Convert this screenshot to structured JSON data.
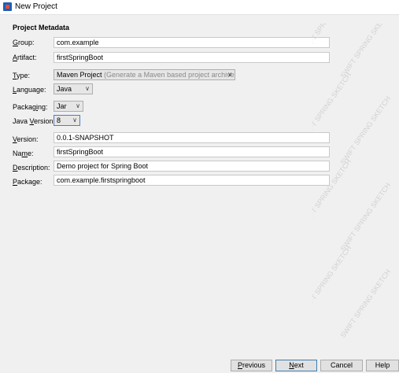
{
  "window": {
    "title": "New Project"
  },
  "section": {
    "title": "Project Metadata"
  },
  "fields": {
    "group": {
      "label_mnemonic": "G",
      "label_rest": "roup:",
      "value": "com.example"
    },
    "artifact": {
      "label_mnemonic": "A",
      "label_rest": "rtifact:",
      "value": "firstSpringBoot"
    },
    "type": {
      "label_mnemonic": "T",
      "label_rest": "ype:",
      "value": "Maven Project",
      "hint": "(Generate a Maven based project archive.)"
    },
    "language": {
      "label_mnemonic": "L",
      "label_rest": "anguage:",
      "value": "Java"
    },
    "packaging": {
      "label_pre": "Packag",
      "label_mnemonic": "i",
      "label_rest": "ng:",
      "value": "Jar"
    },
    "java_version": {
      "label_pre": "Java ",
      "label_mnemonic": "V",
      "label_rest": "ersion:",
      "value": "8"
    },
    "version": {
      "label_mnemonic": "V",
      "label_rest": "ersion:",
      "value": "0.0.1-SNAPSHOT"
    },
    "name": {
      "label_pre": "Na",
      "label_mnemonic": "m",
      "label_rest": "e:",
      "value": "firstSpringBoot"
    },
    "description": {
      "label_mnemonic": "D",
      "label_rest": "escription:",
      "value": "Demo project for Spring Boot"
    },
    "package": {
      "label_mnemonic": "P",
      "label_rest": "ackage:",
      "value": "com.example.firstspringboot"
    }
  },
  "buttons": {
    "previous": {
      "mnemonic": "P",
      "rest": "revious"
    },
    "next": {
      "mnemonic": "N",
      "rest": "ext"
    },
    "cancel": {
      "label": "Cancel"
    },
    "help": {
      "label": "Help"
    }
  },
  "watermark": {
    "text": "SWIFT SPRING SKETCH"
  },
  "colors": {
    "background": "#f0f0f0",
    "focus_border": "#4a7dc9",
    "hint_text": "#8a8a8a"
  },
  "icons": {
    "app": "intellij-app-icon",
    "dropdown": "chevron-down-icon"
  }
}
